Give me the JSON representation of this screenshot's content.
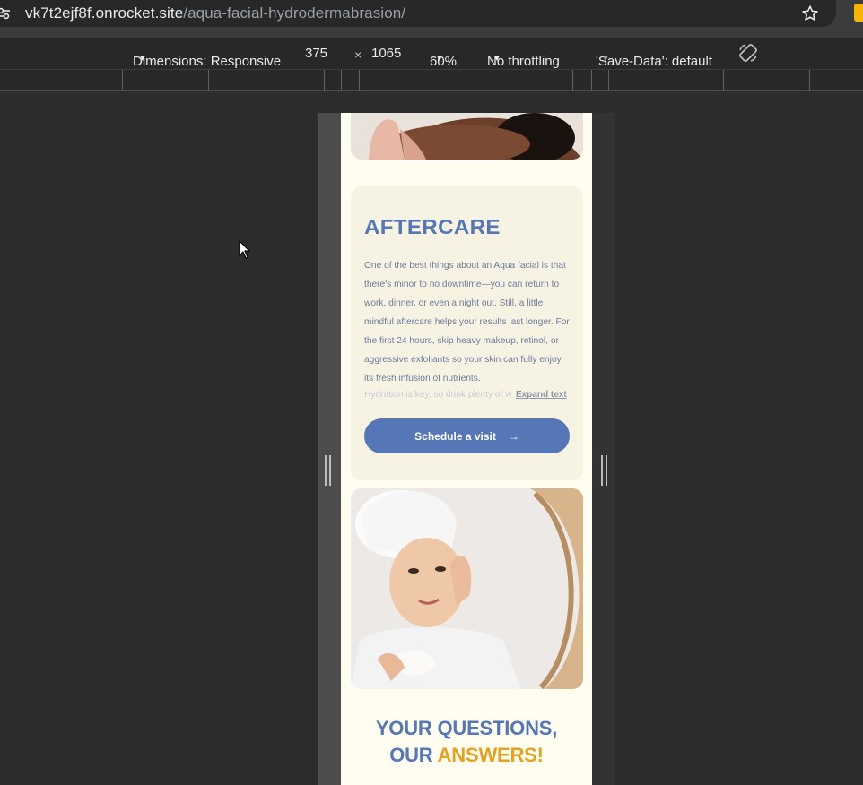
{
  "browser": {
    "url_host": "vk7t2ejf8f.onrocket.site",
    "url_path": "/aqua-facial-hydrodermabrasion/",
    "bookmark_icon": "star-icon",
    "site_info_icon": "tune-icon"
  },
  "devtools": {
    "dimensions_label": "Dimensions: Responsive",
    "width": "375",
    "times": "×",
    "height": "1065",
    "zoom": "60%",
    "throttling": "No throttling",
    "save_data": "'Save-Data': default",
    "rotate_icon": "rotate-icon"
  },
  "page": {
    "aftercare": {
      "title": "AFTERCARE",
      "body": "One of the best things about an Aqua facial is that there's minor to no downtime—you can return to work, dinner, or even a night out. Still, a little mindful aftercare helps your results last longer. For the first 24 hours, skip heavy makeup, retinol, or aggressive exfoliants so your skin can fully enjoy its fresh infusion of nutrients.",
      "faded_line": "Hydration is key, so drink plenty of w",
      "expand_label": "Expand text",
      "button_label": "Schedule a visit",
      "button_arrow": "→"
    },
    "faq": {
      "line1": "YOUR QUESTIONS,",
      "line2_a": "OUR ",
      "line2_b": "ANSWERS!"
    }
  },
  "colors": {
    "brand_blue": "#5576b7",
    "accent_orange": "#e5a220",
    "page_bg": "#fffdf0",
    "card_bg": "#f7f3e3"
  }
}
